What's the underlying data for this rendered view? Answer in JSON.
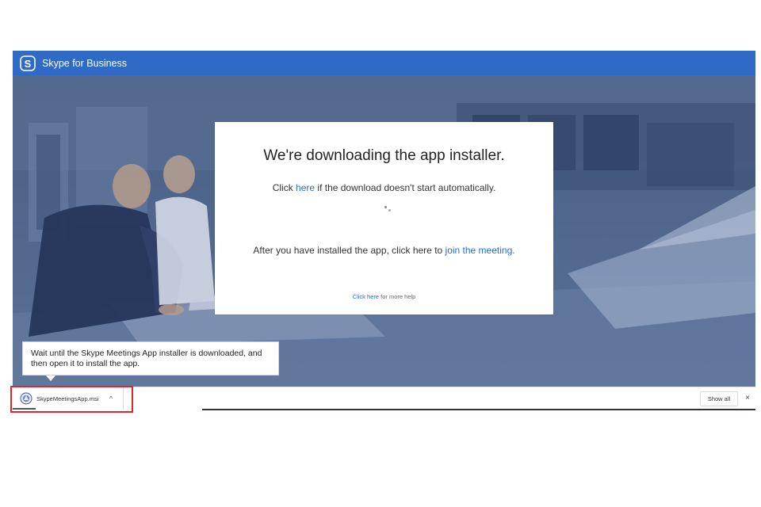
{
  "header": {
    "app_title": "Skype for Business",
    "logo_icon": "skype-logo-icon",
    "brand_color": "#2f6bc6"
  },
  "dialog": {
    "title": "We're downloading the app installer.",
    "line1_prefix": "Click ",
    "line1_link": "here",
    "line1_suffix": " if the download doesn't start automatically.",
    "line2_prefix": "After you have installed the app, click here to ",
    "line2_link": "join the meeting.",
    "help_link": "Click here",
    "help_suffix": " for more help",
    "spinner_icon": "loading-spinner-icon"
  },
  "tooltip": {
    "text": "Wait until the Skype Meetings App installer is downloaded, and then open it to install the app."
  },
  "download_bar": {
    "file_name": "SkypeMeetingsApp.msi",
    "file_icon": "msi-installer-icon",
    "caret": "^",
    "progress": 0.21,
    "show_all_label": "Show all",
    "close_glyph": "×"
  },
  "colors": {
    "link": "#2f6bc6",
    "highlight": "#e0262a"
  }
}
